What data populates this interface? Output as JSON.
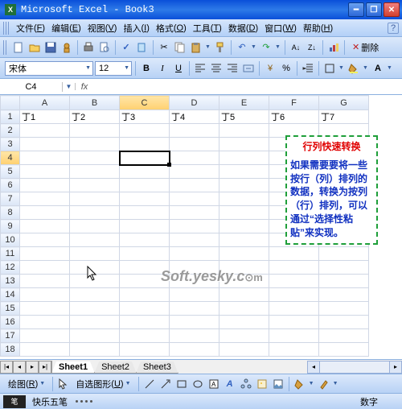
{
  "titlebar": {
    "app": "Microsoft Excel",
    "doc": "Book3"
  },
  "menu": {
    "file": "文件",
    "file_k": "F",
    "edit": "编辑",
    "edit_k": "E",
    "view": "视图",
    "view_k": "V",
    "insert": "插入",
    "insert_k": "I",
    "format": "格式",
    "format_k": "O",
    "tools": "工具",
    "tools_k": "T",
    "data": "数据",
    "data_k": "D",
    "window": "窗口",
    "window_k": "W",
    "help": "帮助",
    "help_k": "H"
  },
  "toolbar": {
    "delete_label": "删除"
  },
  "format": {
    "font": "宋体",
    "size": "12"
  },
  "namebox": "C4",
  "columns": [
    "A",
    "B",
    "C",
    "D",
    "E",
    "F",
    "G"
  ],
  "rows": [
    "1",
    "2",
    "3",
    "4",
    "5",
    "6",
    "7",
    "8",
    "9",
    "10",
    "11",
    "12",
    "13",
    "14",
    "15",
    "16",
    "17",
    "18"
  ],
  "cells": {
    "row1": [
      "丁1",
      "丁2",
      "丁3",
      "丁4",
      "丁5",
      "丁6",
      "丁7"
    ]
  },
  "selected": {
    "col": "C",
    "row": "4"
  },
  "callout": {
    "title": "行列快速转换",
    "body": "如果需要要将一些按行（列）排列的数据，转换为按列（行）排列，可以通过“选择性粘贴”来实现。"
  },
  "watermark": {
    "main": "Soft.yesky.c",
    "suffix": "⊙m"
  },
  "sheets": {
    "s1": "Sheet1",
    "s2": "Sheet2",
    "s3": "Sheet3"
  },
  "drawbar": {
    "draw": "绘图",
    "draw_k": "R",
    "auto": "自选图形",
    "auto_k": "U"
  },
  "status": {
    "ime": "快乐五笔",
    "num": "数字"
  }
}
